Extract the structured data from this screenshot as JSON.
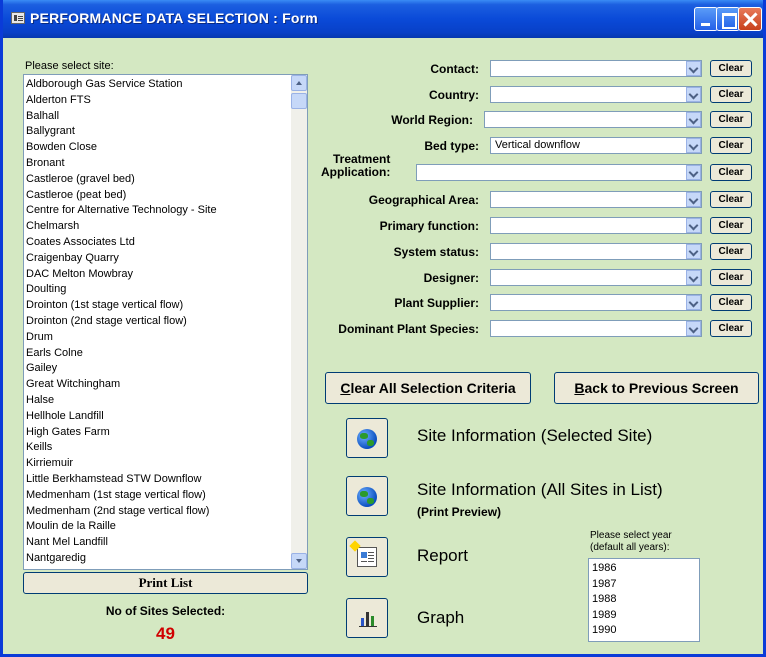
{
  "window": {
    "title": "PERFORMANCE DATA SELECTION : Form"
  },
  "sites": {
    "label": "Please select site:",
    "items": [
      "Aldborough Gas Service Station",
      "Alderton FTS",
      "Balhall",
      "Ballygrant",
      "Bowden Close",
      "Bronant",
      "Castleroe (gravel bed)",
      "Castleroe (peat bed)",
      "Centre for Alternative Technology - Site",
      "Chelmarsh",
      "Coates Associates Ltd",
      "Craigenbay Quarry",
      "DAC Melton Mowbray",
      "Doulting",
      "Drointon (1st stage vertical flow)",
      "Drointon (2nd stage vertical flow)",
      "Drum",
      "Earls Colne",
      "Gailey",
      "Great Witchingham",
      "Halse",
      "Hellhole Landfill",
      "High Gates Farm",
      "Keills",
      "Kirriemuir",
      "Little Berkhamstead STW Downflow",
      "Medmenham (1st stage vertical flow)",
      "Medmenham (2nd stage vertical flow)",
      "Moulin de la Raille",
      "Nant Mel Landfill",
      "Nantgaredig"
    ],
    "print_label": "Print List",
    "selected_label": "No of Sites Selected:",
    "selected_count": "49"
  },
  "filters": {
    "clear_label": "Clear",
    "items": [
      {
        "label": "Contact:",
        "value": ""
      },
      {
        "label": "Country:",
        "value": ""
      },
      {
        "label": "World Region:",
        "value": ""
      },
      {
        "label": "Bed type:",
        "value": "Vertical downflow"
      },
      {
        "label_line1": "Treatment",
        "label_line2": "Application:",
        "value": ""
      },
      {
        "label": "Geographical Area:",
        "value": ""
      },
      {
        "label": "Primary function:",
        "value": ""
      },
      {
        "label": "System status:",
        "value": ""
      },
      {
        "label": "Designer:",
        "value": ""
      },
      {
        "label": "Plant Supplier:",
        "value": ""
      },
      {
        "label": "Dominant Plant Species:",
        "value": ""
      }
    ]
  },
  "buttons": {
    "clear_all_accel": "C",
    "clear_all_rest": "lear All Selection Criteria",
    "back_accel": "B",
    "back_rest": "ack to Previous Screen"
  },
  "actions": {
    "site_info_selected": "Site Information (Selected Site)",
    "site_info_all": "Site Information (All Sites in List)",
    "print_preview": "(Print Preview)",
    "report": "Report",
    "graph": "Graph"
  },
  "years": {
    "label_line1": "Please select year",
    "label_line2": "(default all years):",
    "items": [
      "1986",
      "1987",
      "1988",
      "1989",
      "1990"
    ]
  },
  "icons": [
    "form-icon",
    "minimize-icon",
    "maximize-icon",
    "close-icon",
    "globe-icon",
    "report-icon",
    "graph-icon",
    "dropdown-arrow-icon"
  ],
  "colors": {
    "title_bar": "#0a4ad8",
    "form_background": "#d4e8c2",
    "count_color": "#d00000"
  }
}
